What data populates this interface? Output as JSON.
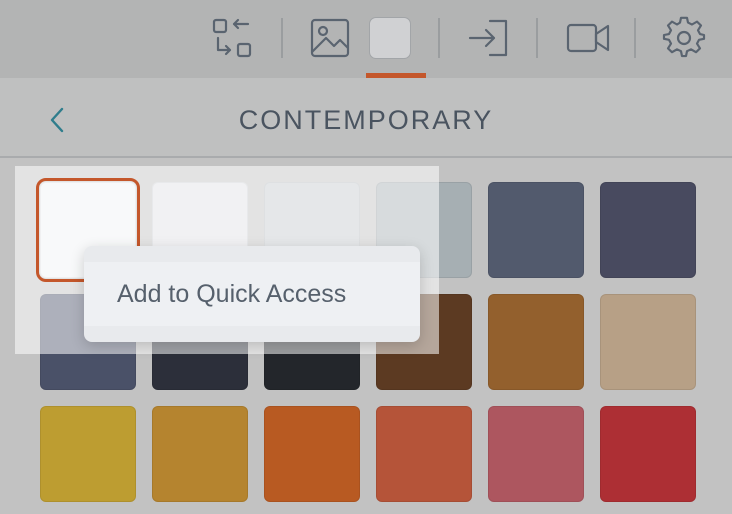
{
  "toolbar": {
    "buttons": [
      {
        "name": "swap-icon"
      },
      {
        "name": "image-icon"
      },
      {
        "name": "color-swatch-icon",
        "selected": true
      },
      {
        "name": "enter-icon"
      },
      {
        "name": "video-camera-icon"
      },
      {
        "name": "gear-icon"
      }
    ],
    "accent": "#c4572b"
  },
  "header": {
    "back_icon": "chevron-left-icon",
    "title": "CONTEMPORARY"
  },
  "palette": {
    "rows": [
      [
        "#f0f1f4",
        "#dfe1e4",
        "#c5cbcf",
        "#a6afb3",
        "#525a6d",
        "#484a5f"
      ],
      [
        "#4a5168",
        "#2c2f3a",
        "#23262b",
        "#5c3a22",
        "#93602d",
        "#b7a086"
      ],
      [
        "#bd9d31",
        "#b5842f",
        "#b85a22",
        "#b55439",
        "#ad565f",
        "#ad2f34"
      ]
    ],
    "selected_index": 0
  },
  "context_menu": {
    "items": [
      {
        "label": "Add to Quick Access"
      }
    ]
  }
}
